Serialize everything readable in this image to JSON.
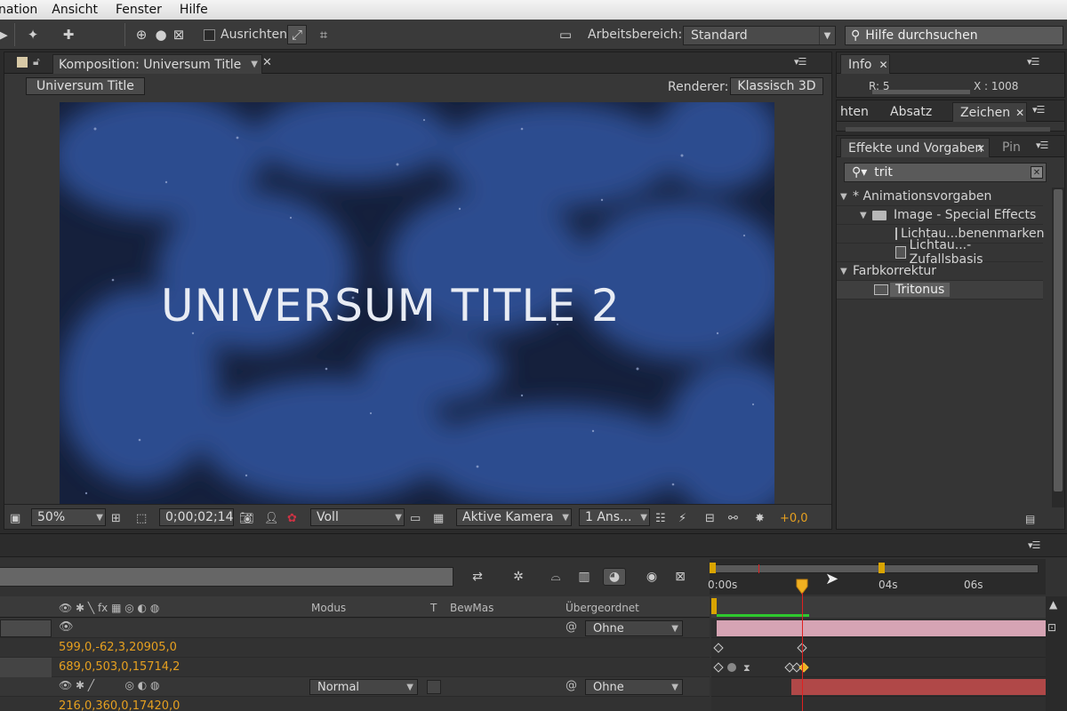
{
  "menu": {
    "items": [
      "nation",
      "Ansicht",
      "Fenster",
      "Hilfe"
    ]
  },
  "toolbar": {
    "align_label": "Ausrichten",
    "workspace_label": "Arbeitsbereich:",
    "workspace_value": "Standard",
    "help_search_placeholder": "Hilfe durchsuchen"
  },
  "composition": {
    "tab_label": "Komposition: Universum Title",
    "breadcrumb": "Universum Title",
    "renderer_label": "Renderer:",
    "renderer_value": "Klassisch 3D",
    "preview_text": "UNIVERSUM TITLE 2",
    "footer": {
      "zoom": "50%",
      "timecode": "0;00;02;14",
      "resolution": "Voll",
      "camera": "Aktive Kamera",
      "views": "1 Ans...",
      "exposure": "+0,0"
    }
  },
  "info_panel": {
    "tab_label": "Info",
    "readout_r": "R: 5",
    "readout_x": "X : 1008"
  },
  "char_panel": {
    "tabs": [
      "hten",
      "Absatz",
      "Zeichen"
    ]
  },
  "effects_panel": {
    "tab_label": "Effekte und Vorgaben",
    "tab2_label": "Pin",
    "search_value": "trit",
    "tree": [
      {
        "label": "* Animationsvorgaben",
        "level": 0,
        "kind": "category"
      },
      {
        "label": "Image - Special Effects",
        "level": 1,
        "kind": "folder"
      },
      {
        "label": "Lichtau...benenmarken",
        "level": 2,
        "kind": "preset"
      },
      {
        "label": "Lichtau...- Zufallsbasis",
        "level": 2,
        "kind": "preset"
      },
      {
        "label": "Farbkorrektur",
        "level": 0,
        "kind": "category"
      },
      {
        "label": "Tritonus",
        "level": 1,
        "kind": "effect",
        "selected": true
      }
    ]
  },
  "timeline": {
    "columns": {
      "mode": "Modus",
      "t": "T",
      "trkmat": "BewMas",
      "parent": "Übergeordnet"
    },
    "ticks": [
      "0:00s",
      "04s",
      "06s"
    ],
    "current_time_seconds": 2.47,
    "rows": [
      {
        "value": "",
        "parent": "Ohne"
      },
      {
        "value": "599,0,-62,3,20905,0"
      },
      {
        "value": "689,0,503,0,15714,2"
      },
      {
        "value": "",
        "mode": "Normal",
        "parent": "Ohne"
      },
      {
        "value": "216,0,360,0,17420,0"
      }
    ]
  },
  "colors": {
    "accent_orange": "#e6a020",
    "cti_red": "#e02020",
    "work_area_yellow": "#d9a400",
    "layer_pink": "#d6a4b4",
    "layer_red": "#b04848"
  }
}
